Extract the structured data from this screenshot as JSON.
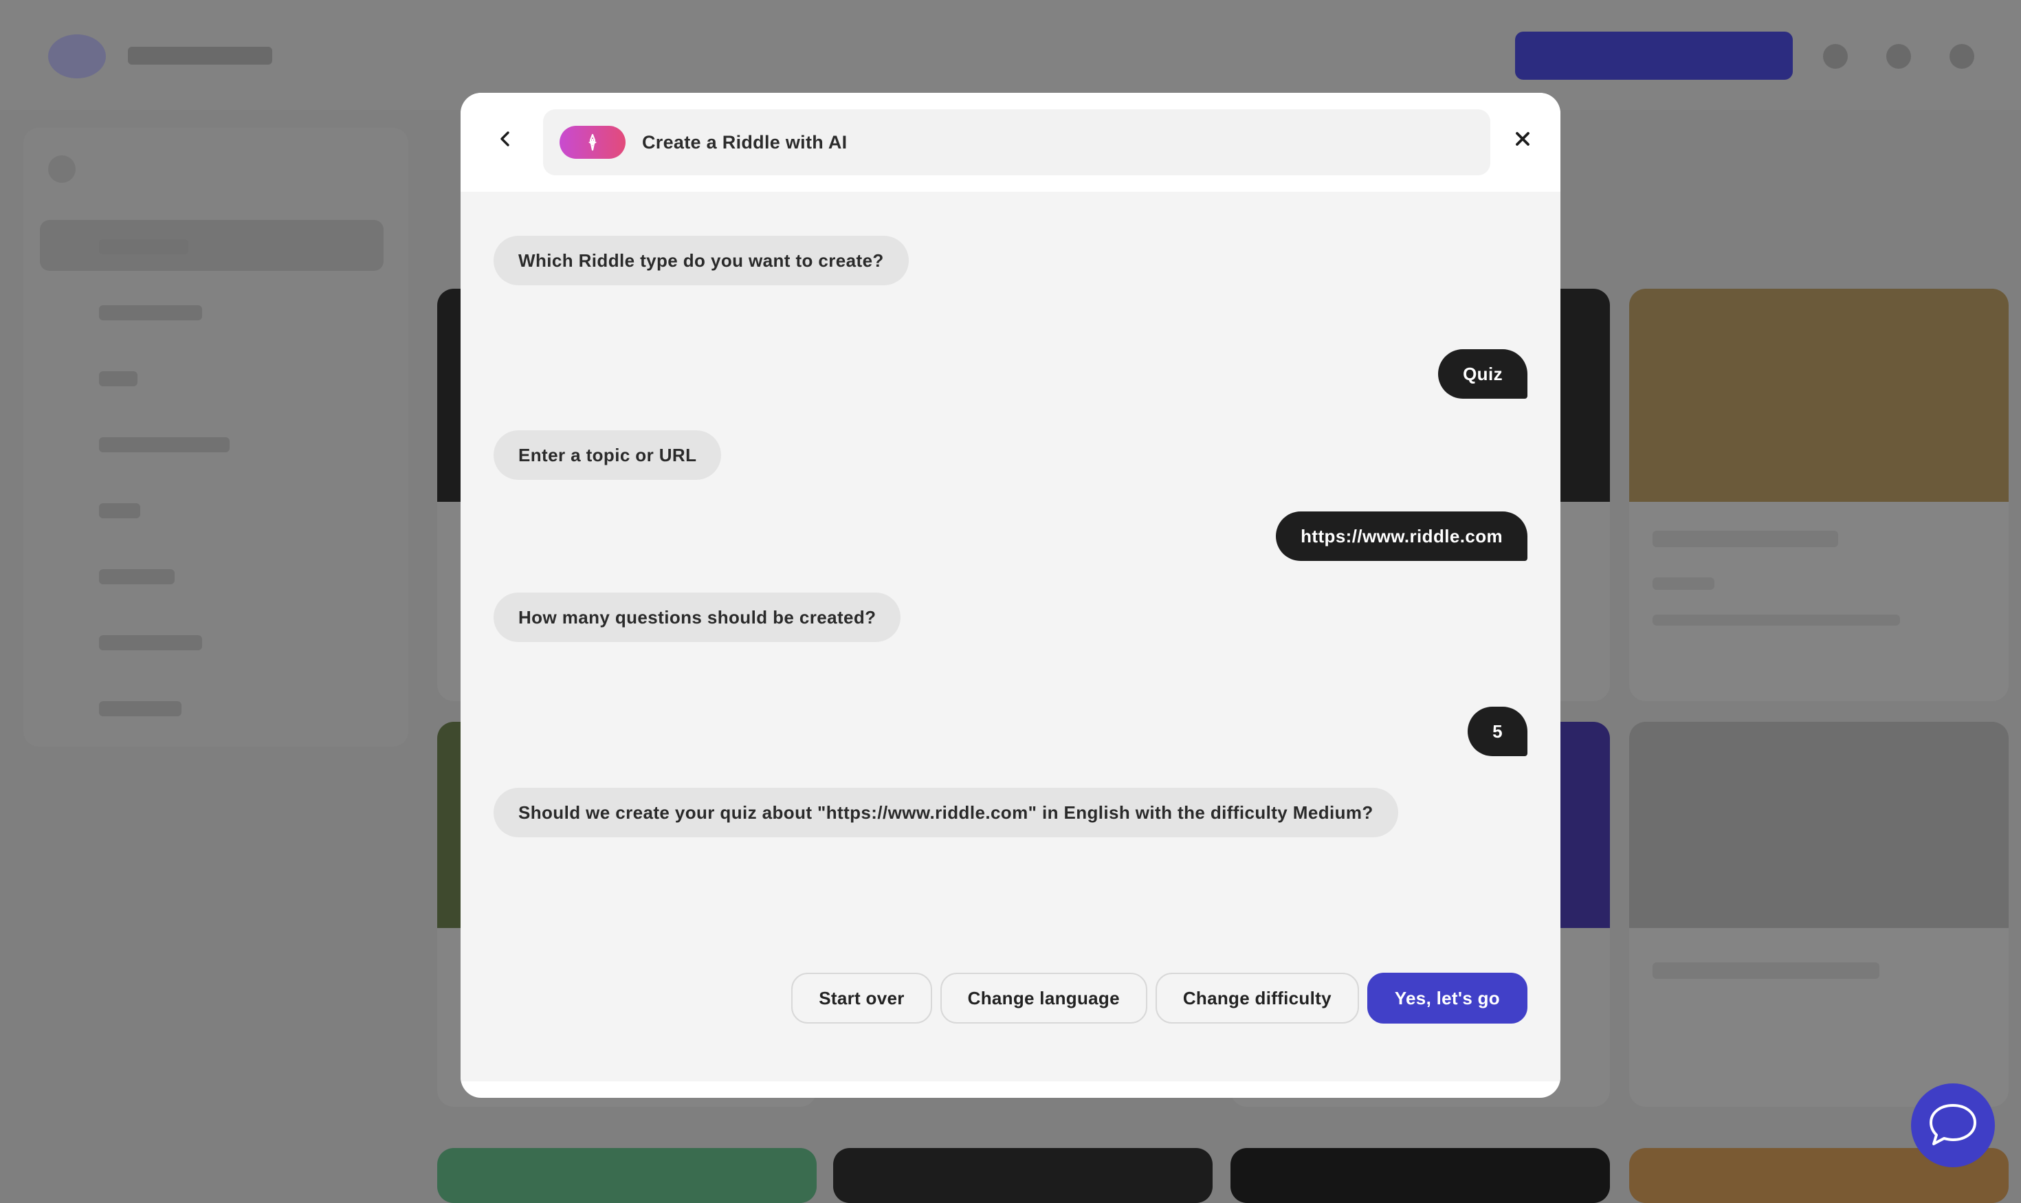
{
  "modal": {
    "title": "Create a Riddle with AI"
  },
  "chat": [
    {
      "role": "bot",
      "text": "Which Riddle type do you want to create?"
    },
    {
      "role": "user",
      "text": "Quiz"
    },
    {
      "role": "bot",
      "text": "Enter a topic or URL"
    },
    {
      "role": "user",
      "text": "https://www.riddle.com"
    },
    {
      "role": "bot",
      "text": "How many questions should be created?"
    },
    {
      "role": "user",
      "text": "5"
    },
    {
      "role": "bot",
      "text": "Should we create your quiz about \"https://www.riddle.com\" in English with the difficulty Medium?"
    }
  ],
  "actions": {
    "start_over": "Start over",
    "change_language": "Change language",
    "change_difficulty": "Change difficulty",
    "confirm": "Yes, let's go"
  },
  "colors": {
    "overlay": "#7f7f7f",
    "accent": "#4140c8",
    "ai_gradient_start": "#c84bd0",
    "ai_gradient_end": "#e24b7b",
    "user_bubble": "#1e1e1e",
    "bot_bubble": "#e4e4e4"
  },
  "icons": {
    "back": "chevron-left-icon",
    "close": "close-icon",
    "ai": "sparkle-icon",
    "chat": "chat-bubble-icon"
  }
}
